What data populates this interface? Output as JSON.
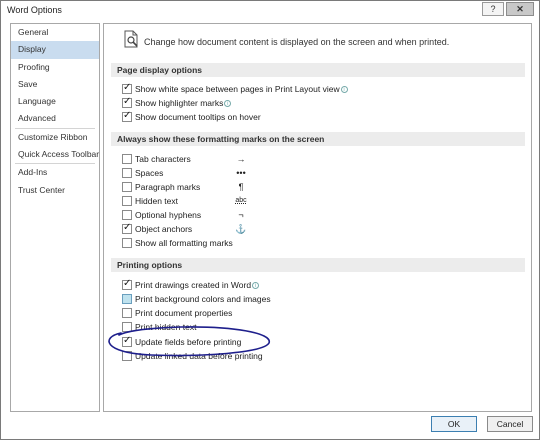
{
  "window": {
    "title": "Word Options",
    "help_label": "?",
    "close_label": "✕"
  },
  "sidebar": {
    "items": [
      {
        "label": "General"
      },
      {
        "label": "Display"
      },
      {
        "label": "Proofing"
      },
      {
        "label": "Save"
      },
      {
        "label": "Language"
      },
      {
        "label": "Advanced"
      },
      {
        "label": "Customize Ribbon"
      },
      {
        "label": "Quick Access Toolbar"
      },
      {
        "label": "Add-Ins"
      },
      {
        "label": "Trust Center"
      }
    ],
    "selected": "Display"
  },
  "header": {
    "text": "Change how document content is displayed on the screen and when printed."
  },
  "sections": {
    "page_display": {
      "title": "Page display options",
      "options": [
        {
          "label": "Show white space between pages in Print Layout view",
          "checked": true,
          "info": true
        },
        {
          "label": "Show highlighter marks",
          "checked": true,
          "info": true
        },
        {
          "label": "Show document tooltips on hover",
          "checked": true,
          "info": false
        }
      ]
    },
    "formatting_marks": {
      "title": "Always show these formatting marks on the screen",
      "options": [
        {
          "label": "Tab characters",
          "checked": false,
          "symbol": "→"
        },
        {
          "label": "Spaces",
          "checked": false,
          "symbol": "•••"
        },
        {
          "label": "Paragraph marks",
          "checked": false,
          "symbol": "¶"
        },
        {
          "label": "Hidden text",
          "checked": false,
          "symbol": "abc"
        },
        {
          "label": "Optional hyphens",
          "checked": false,
          "symbol": "¬"
        },
        {
          "label": "Object anchors",
          "checked": true,
          "symbol": "⚓"
        },
        {
          "label": "Show all formatting marks",
          "checked": false,
          "symbol": ""
        }
      ]
    },
    "printing": {
      "title": "Printing options",
      "options": [
        {
          "label": "Print drawings created in Word",
          "checked": true,
          "info": true
        },
        {
          "label": "Print background colors and images",
          "checked": false,
          "highlighted": true
        },
        {
          "label": "Print document properties",
          "checked": false
        },
        {
          "label": "Print hidden text",
          "checked": false
        },
        {
          "label": "Update fields before printing",
          "checked": true
        },
        {
          "label": "Update linked data before printing",
          "checked": false
        }
      ]
    }
  },
  "buttons": {
    "ok": "OK",
    "cancel": "Cancel"
  },
  "info_glyph": "i",
  "colors": {
    "selected_nav": "#c9dcef",
    "section_header": "#ececec",
    "annotation_ink": "#1e1f8c"
  }
}
